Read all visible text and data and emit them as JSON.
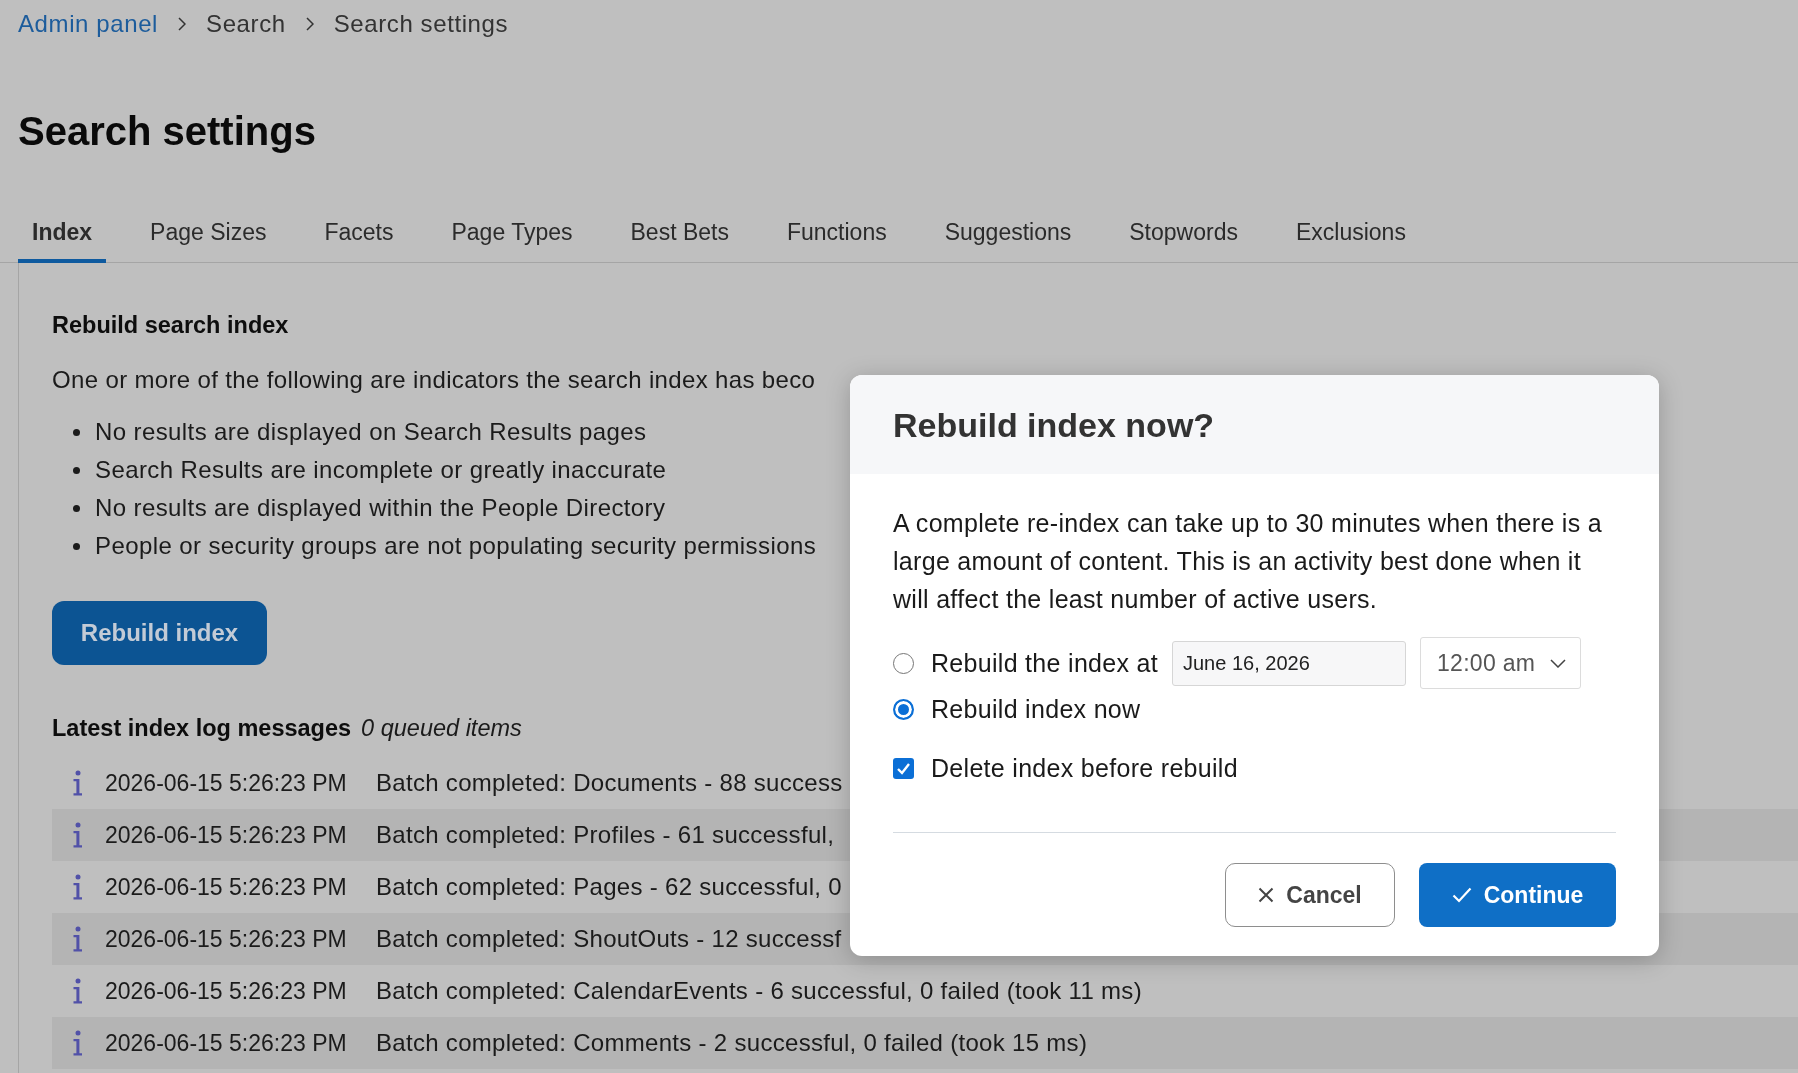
{
  "breadcrumb": [
    {
      "label": "Admin panel",
      "kind": "link"
    },
    {
      "label": "Search",
      "kind": "text"
    },
    {
      "label": "Search settings",
      "kind": "text"
    }
  ],
  "page_title": "Search settings",
  "tabs": [
    {
      "label": "Index",
      "selected": true
    },
    {
      "label": "Page Sizes",
      "selected": false
    },
    {
      "label": "Facets",
      "selected": false
    },
    {
      "label": "Page Types",
      "selected": false
    },
    {
      "label": "Best Bets",
      "selected": false
    },
    {
      "label": "Functions",
      "selected": false
    },
    {
      "label": "Suggestions",
      "selected": false
    },
    {
      "label": "Stopwords",
      "selected": false
    },
    {
      "label": "Exclusions",
      "selected": false
    }
  ],
  "rebuild_section": {
    "heading": "Rebuild search index",
    "intro": "One or more of the following are indicators the search index has beco",
    "indicators": [
      "No results are displayed on Search Results pages",
      "Search Results are incomplete or greatly inaccurate",
      "No results are displayed within the People Directory",
      "People or security groups are not populating security permissions"
    ],
    "button": "Rebuild index"
  },
  "log": {
    "heading": "Latest index log messages",
    "queued": "0 queued items",
    "rows": [
      {
        "time": "2026-06-15 5:26:23 PM",
        "message": "Batch completed: Documents - 88 success"
      },
      {
        "time": "2026-06-15 5:26:23 PM",
        "message": "Batch completed: Profiles - 61 successful,"
      },
      {
        "time": "2026-06-15 5:26:23 PM",
        "message": "Batch completed: Pages - 62 successful, 0"
      },
      {
        "time": "2026-06-15 5:26:23 PM",
        "message": "Batch completed: ShoutOuts - 12 successf"
      },
      {
        "time": "2026-06-15 5:26:23 PM",
        "message": "Batch completed: CalendarEvents - 6 successful, 0 failed (took 11 ms)"
      },
      {
        "time": "2026-06-15 5:26:23 PM",
        "message": "Batch completed: Comments - 2 successful, 0 failed (took 15 ms)"
      }
    ]
  },
  "dialog": {
    "title": "Rebuild index now?",
    "body": "A complete re-index can take up to 30 minutes when there is a large amount of content. This is an activity best done when it will affect the least number of active users.",
    "options": [
      {
        "label": "Rebuild the index at",
        "selected": false,
        "date": "June 16, 2026",
        "time": "12:00 am"
      },
      {
        "label": "Rebuild index now",
        "selected": true
      }
    ],
    "delete_before_rebuild": {
      "label": "Delete index before rebuild",
      "checked": true
    },
    "buttons": [
      {
        "label": "Cancel",
        "kind": "secondary"
      },
      {
        "label": "Continue",
        "kind": "primary"
      }
    ]
  }
}
